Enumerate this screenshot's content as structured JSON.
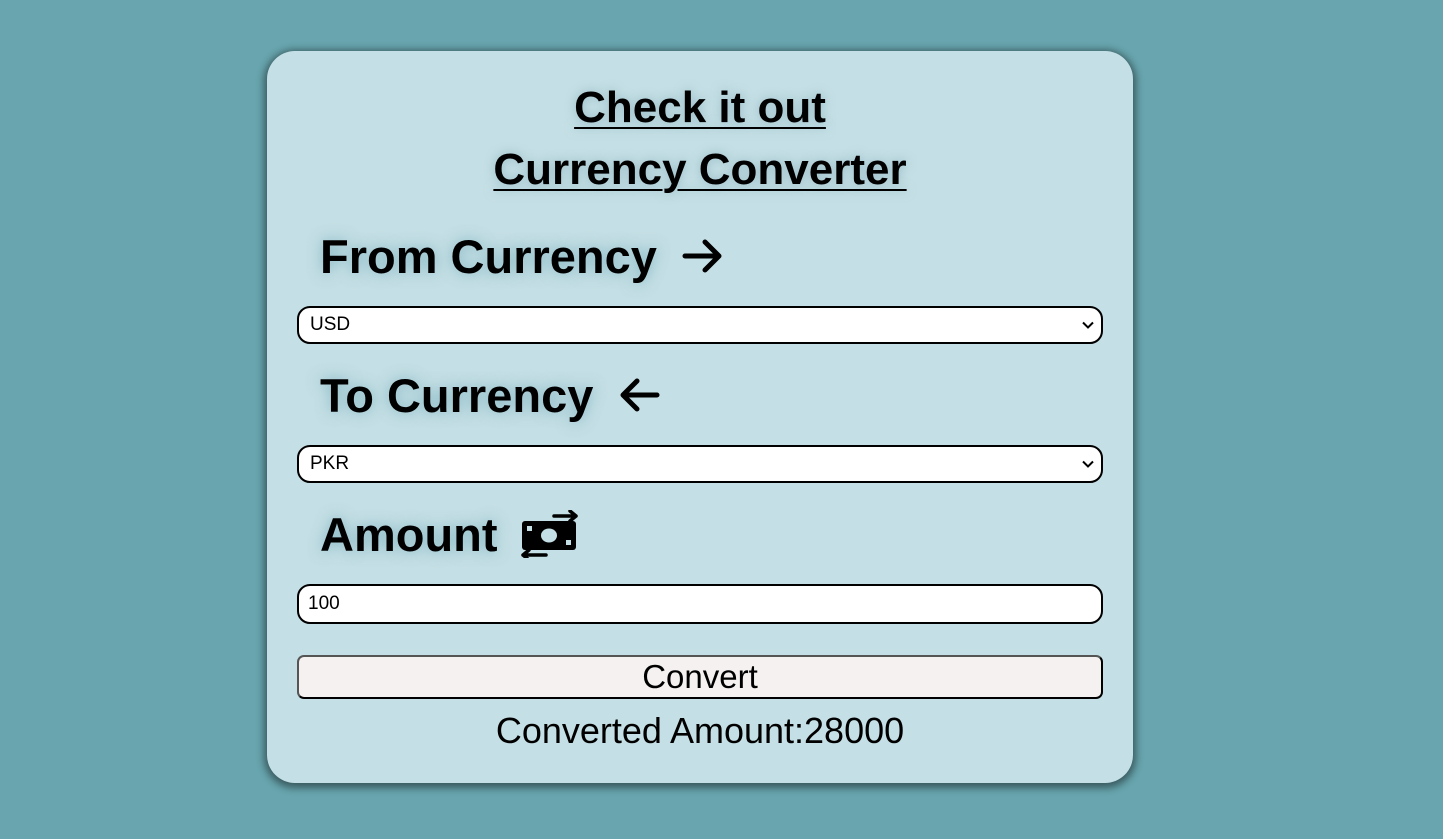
{
  "header": {
    "title_line1": "Check it out",
    "title_line2": "Currency Converter"
  },
  "from": {
    "label": "From Currency",
    "icon": "arrow-right-icon",
    "selected": "USD"
  },
  "to": {
    "label": "To Currency",
    "icon": "arrow-left-icon",
    "selected": "PKR"
  },
  "amount": {
    "label": "Amount",
    "icon": "money-exchange-icon",
    "value": "100"
  },
  "actions": {
    "convert_label": "Convert"
  },
  "result": {
    "text": "Converted Amount:28000"
  },
  "colors": {
    "background": "#68a5ae",
    "card": "#c4dfe5",
    "button": "#f5f1f0"
  }
}
